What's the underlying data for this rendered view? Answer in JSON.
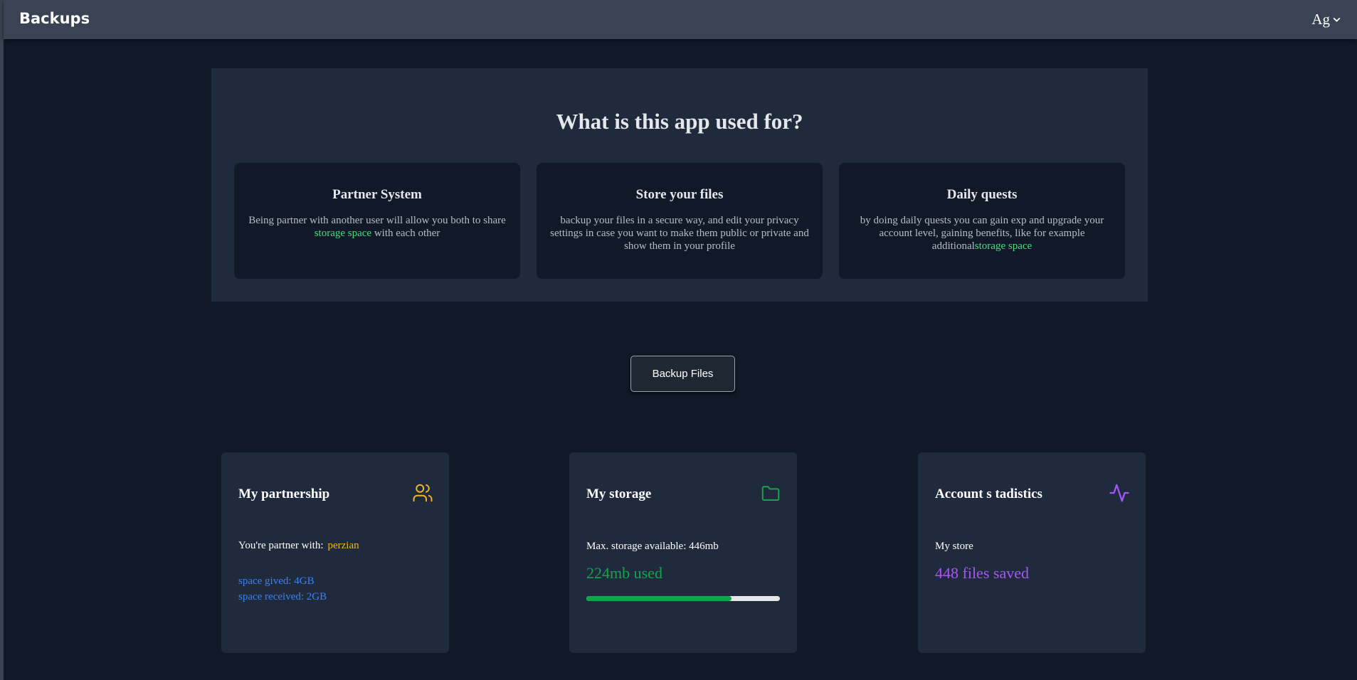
{
  "header": {
    "brand": "Backups",
    "user_label": "Ag"
  },
  "info": {
    "title": "What is this app used for?",
    "features": [
      {
        "title": "Partner System",
        "text_before": "Being partner with another user will allow you both to share ",
        "highlight": "storage space",
        "text_after": " with each other"
      },
      {
        "title": "Store your files",
        "text_before": "backup your files in a secure way, and edit your privacy settings in case you want to make them public or private and show them in your profile",
        "highlight": "",
        "text_after": ""
      },
      {
        "title": "Daily quests",
        "text_before": "by doing daily quests you can gain exp and upgrade your account level, gaining benefits, like for example additional",
        "highlight": "storage space",
        "text_after": ""
      }
    ]
  },
  "actions": {
    "backup_label": "Backup Files"
  },
  "cards": {
    "partnership": {
      "title": "My partnership",
      "partner_label": "You're partner with:",
      "partner_name": "perzian",
      "space_gived": "space gived: 4GB",
      "space_received": "space received: 2GB",
      "icon": "users-icon"
    },
    "storage": {
      "title": "My storage",
      "max_label": "Max. storage available: 446mb",
      "used_label": "224mb used",
      "used_fraction": 0.75,
      "icon": "folder-icon"
    },
    "stats": {
      "title": "Account s tadistics",
      "store_label": "My store",
      "files_label": "448 files saved",
      "icon": "activity-icon"
    }
  },
  "colors": {
    "background": "#111827",
    "panel": "#1f2a3d",
    "topbar": "#3a4354",
    "accent_green": "#16a34a",
    "accent_yellow": "#f0b429",
    "accent_blue": "#3b82f6",
    "accent_purple": "#a855f7"
  }
}
